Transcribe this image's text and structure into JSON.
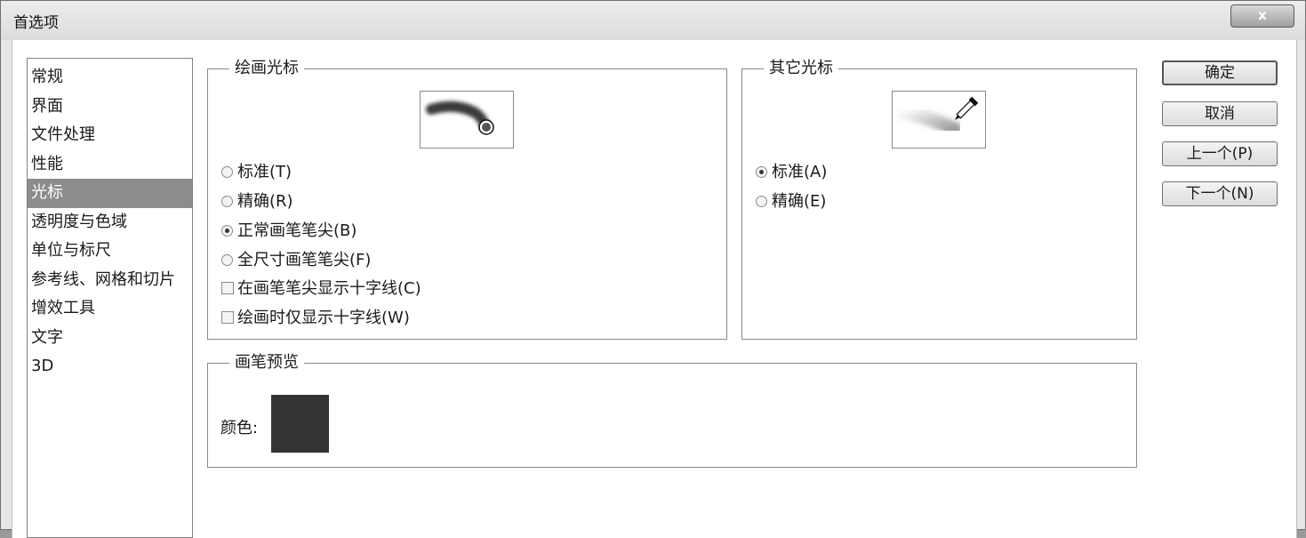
{
  "window": {
    "title": "首选项",
    "close_label": "x"
  },
  "categories": [
    {
      "label": "常规",
      "selected": false
    },
    {
      "label": "界面",
      "selected": false
    },
    {
      "label": "文件处理",
      "selected": false
    },
    {
      "label": "性能",
      "selected": false
    },
    {
      "label": "光标",
      "selected": true
    },
    {
      "label": "透明度与色域",
      "selected": false
    },
    {
      "label": "单位与标尺",
      "selected": false
    },
    {
      "label": "参考线、网格和切片",
      "selected": false
    },
    {
      "label": "增效工具",
      "selected": false
    },
    {
      "label": "文字",
      "selected": false
    },
    {
      "label": "3D",
      "selected": false
    }
  ],
  "painting_cursors": {
    "title": "绘画光标",
    "preview_icon": "brush-stroke-icon",
    "options": [
      {
        "label": "标准(T)",
        "checked": false
      },
      {
        "label": "精确(R)",
        "checked": false
      },
      {
        "label": "正常画笔笔尖(B)",
        "checked": true
      },
      {
        "label": "全尺寸画笔笔尖(F)",
        "checked": false
      }
    ],
    "checkboxes": [
      {
        "label": "在画笔笔尖显示十字线(C)",
        "checked": false
      },
      {
        "label": "绘画时仅显示十字线(W)",
        "checked": false
      }
    ]
  },
  "other_cursors": {
    "title": "其它光标",
    "preview_icon": "eyedropper-icon",
    "options": [
      {
        "label": "标准(A)",
        "checked": true
      },
      {
        "label": "精确(E)",
        "checked": false
      }
    ]
  },
  "brush_preview": {
    "title": "画笔预览",
    "color_label": "颜色:",
    "color": "#333333"
  },
  "buttons": {
    "ok": "确定",
    "cancel": "取消",
    "prev": "上一个(P)",
    "next": "下一个(N)"
  }
}
